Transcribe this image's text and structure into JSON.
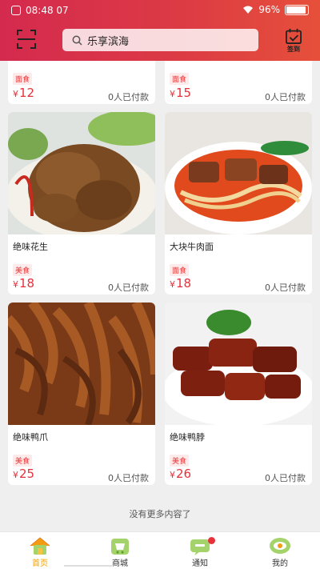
{
  "status_bar": {
    "time": "08:48 07",
    "battery": "96%"
  },
  "header": {
    "search_text": "乐享滨海",
    "checkin_label": "签到",
    "icons": {
      "scan": "scan-icon",
      "checkin": "calendar-check-icon",
      "search": "search-icon"
    }
  },
  "products": [
    {
      "name": "",
      "tag": "面食",
      "price": "12",
      "sold": "0人已付款"
    },
    {
      "name": "",
      "tag": "面食",
      "price": "15",
      "sold": "0人已付款"
    },
    {
      "name": "绝味花生",
      "tag": "美食",
      "price": "18",
      "sold": "0人已付款"
    },
    {
      "name": "大块牛肉面",
      "tag": "面食",
      "price": "18",
      "sold": "0人已付款"
    },
    {
      "name": "绝味鸭爪",
      "tag": "美食",
      "price": "25",
      "sold": "0人已付款"
    },
    {
      "name": "绝味鸭脖",
      "tag": "美食",
      "price": "26",
      "sold": "0人已付款"
    }
  ],
  "currency_symbol": "¥",
  "end_text": "没有更多内容了",
  "tabbar": [
    {
      "label": "首页",
      "icon": "home-icon",
      "active": true
    },
    {
      "label": "商城",
      "icon": "shop-icon",
      "active": false
    },
    {
      "label": "通知",
      "icon": "message-icon",
      "active": false,
      "badge": true
    },
    {
      "label": "我的",
      "icon": "profile-eye-icon",
      "active": false
    }
  ],
  "colors": {
    "header_start": "#d42a4e",
    "header_end": "#e6503a",
    "price": "#e6303a",
    "active_tab": "#f0a000"
  }
}
